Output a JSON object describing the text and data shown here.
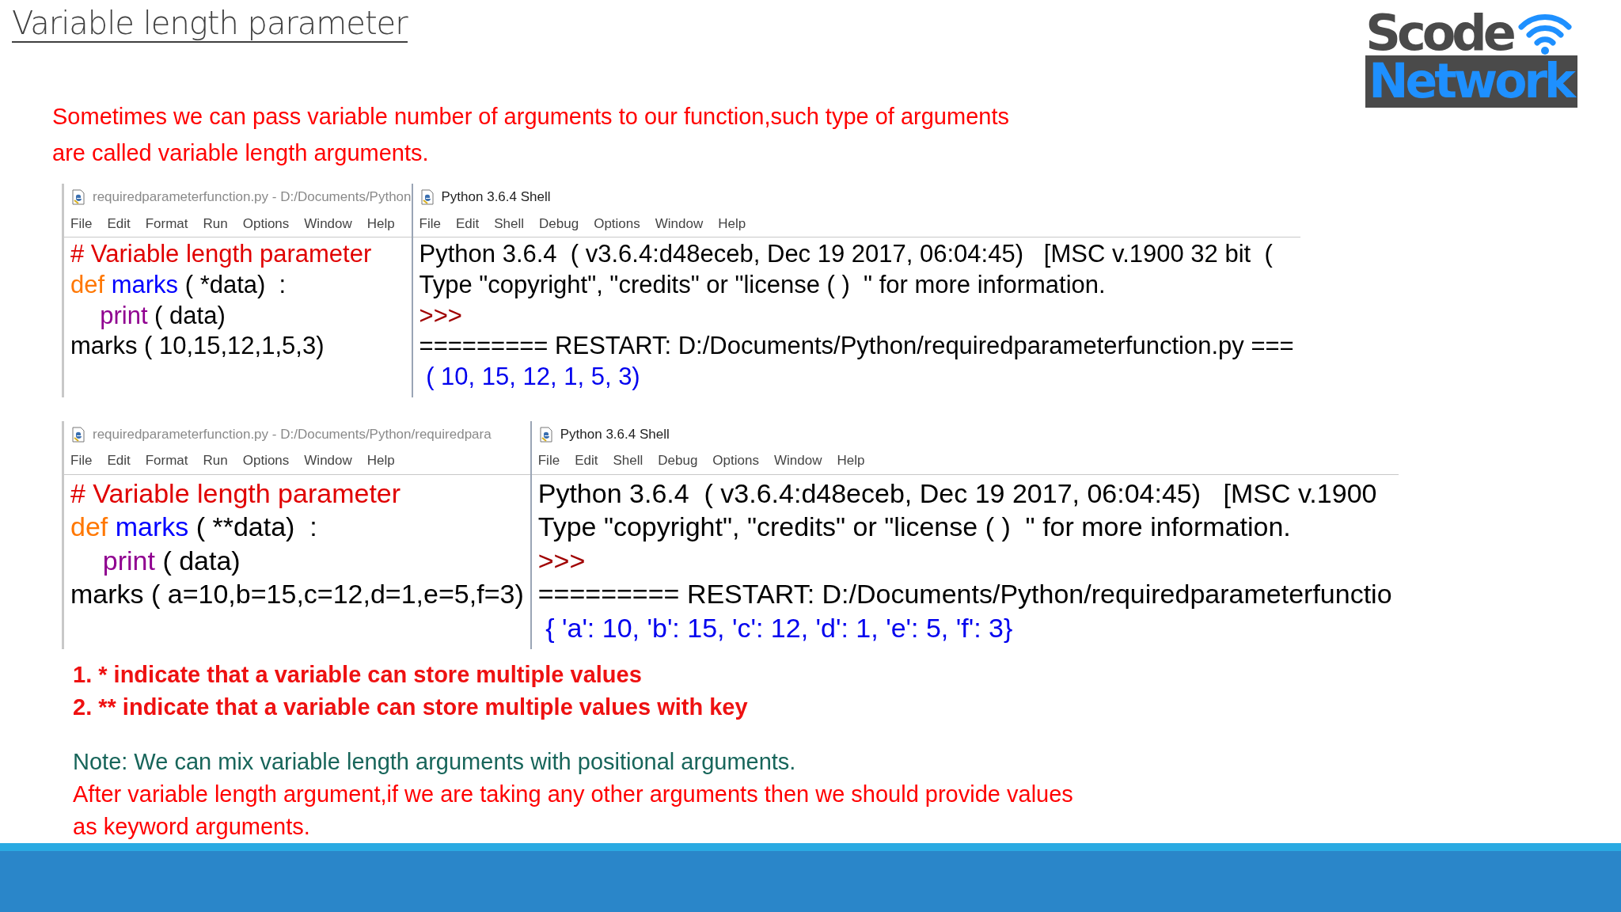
{
  "slide": {
    "title": "Variable length parameter",
    "intro": "Sometimes we can pass variable number of arguments to our function,such type of arguments are called variable length arguments.",
    "logo": {
      "top": "Scode",
      "bottom": "Network"
    }
  },
  "figures": [
    {
      "editor": {
        "title": "requiredparameterfunction.py - D:/Documents/Python",
        "menu": [
          "File",
          "Edit",
          "Format",
          "Run",
          "Options",
          "Window",
          "Help"
        ],
        "lines": [
          [
            {
              "text": "# Variable length parameter",
              "kind": "comment"
            }
          ],
          [
            {
              "text": "def",
              "kind": "keyword"
            },
            {
              "text": " marks",
              "kind": "name"
            },
            {
              "text": " ( *data)  :",
              "kind": "plain"
            }
          ],
          [
            {
              "text": "print",
              "kind": "builtin",
              "indented": true
            },
            {
              "text": " ( data)",
              "kind": "plain"
            }
          ],
          [
            {
              "text": "marks ( 10,15,12,1,5,3)",
              "kind": "plain"
            }
          ]
        ]
      },
      "shell": {
        "title": "Python 3.6.4 Shell",
        "menu": [
          "File",
          "Edit",
          "Shell",
          "Debug",
          "Options",
          "Window",
          "Help"
        ],
        "lines": [
          [
            {
              "text": "Python 3.6.4  ( v3.6.4:d48eceb, Dec 19 2017, 06:04:45)   [MSC v.1900 32 bit  (",
              "kind": "plain"
            }
          ],
          [
            {
              "text": "Type \"copyright\", \"credits\" or \"license ( )  \" for more information.",
              "kind": "plain"
            }
          ],
          [
            {
              "text": ">>>",
              "kind": "prompt"
            }
          ],
          [
            {
              "text": "========= RESTART: D:/Documents/Python/requiredparameterfunction.py ===",
              "kind": "plain"
            }
          ],
          [
            {
              "text": " ( 10, 15, 12, 1, 5, 3)",
              "kind": "output"
            }
          ]
        ]
      }
    },
    {
      "editor": {
        "title": "requiredparameterfunction.py - D:/Documents/Python/requiredpara",
        "menu": [
          "File",
          "Edit",
          "Format",
          "Run",
          "Options",
          "Window",
          "Help"
        ],
        "lines": [
          [
            {
              "text": "# Variable length parameter",
              "kind": "comment"
            }
          ],
          [
            {
              "text": "def",
              "kind": "keyword"
            },
            {
              "text": " marks",
              "kind": "name"
            },
            {
              "text": " ( **data)  :",
              "kind": "plain"
            }
          ],
          [
            {
              "text": "print",
              "kind": "builtin",
              "indented": true
            },
            {
              "text": " ( data)",
              "kind": "plain"
            }
          ],
          [
            {
              "text": "marks ( a=10,b=15,c=12,d=1,e=5,f=3)",
              "kind": "plain"
            }
          ]
        ]
      },
      "shell": {
        "title": "Python 3.6.4 Shell",
        "menu": [
          "File",
          "Edit",
          "Shell",
          "Debug",
          "Options",
          "Window",
          "Help"
        ],
        "lines": [
          [
            {
              "text": "Python 3.6.4  ( v3.6.4:d48eceb, Dec 19 2017, 06:04:45)   [MSC v.1900",
              "kind": "plain"
            }
          ],
          [
            {
              "text": "Type \"copyright\", \"credits\" or \"license ( )  \" for more information.",
              "kind": "plain"
            }
          ],
          [
            {
              "text": ">>>",
              "kind": "prompt"
            }
          ],
          [
            {
              "text": "========= RESTART: D:/Documents/Python/requiredparameterfunctio",
              "kind": "plain"
            }
          ],
          [
            {
              "text": " { 'a': 10, 'b': 15, 'c': 12, 'd': 1, 'e': 5, 'f': 3}",
              "kind": "output"
            }
          ]
        ]
      }
    }
  ],
  "points": [
    "1. * indicate that a variable can store multiple values",
    "2. ** indicate that a variable can store multiple values with key"
  ],
  "notes": [
    {
      "text": "Note: We can mix variable length arguments with positional arguments.",
      "kind": "note"
    },
    {
      "text": "After variable length argument,if we are taking any other arguments then we should provide values as keyword arguments.",
      "kind": "warning"
    }
  ]
}
